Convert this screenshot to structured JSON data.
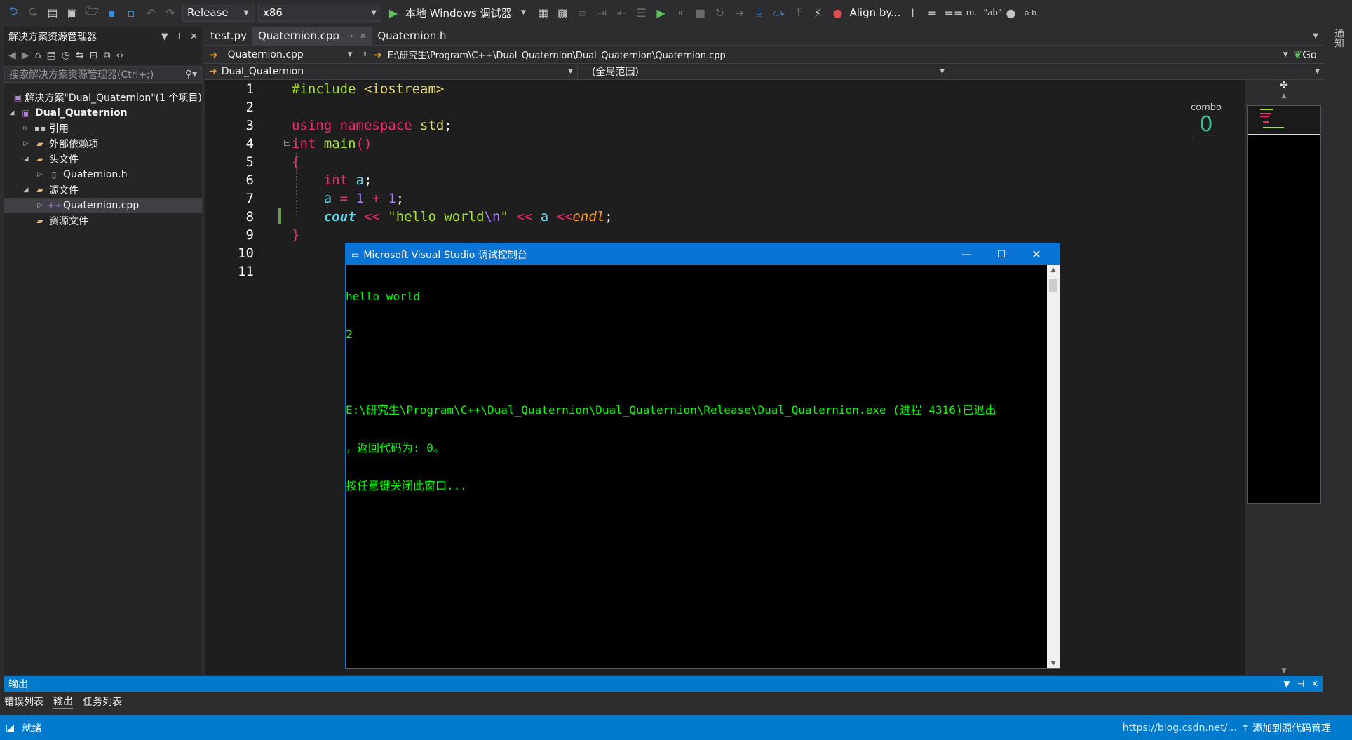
{
  "toolbar": {
    "configuration": "Release",
    "platform": "x86",
    "debugger_label": "本地 Windows 调试器",
    "align_label": "Align by..."
  },
  "right_strip": {
    "label": "通知"
  },
  "solution_explorer": {
    "title": "解决方案资源管理器",
    "search_placeholder": "搜索解决方案资源管理器(Ctrl+;)",
    "items": [
      {
        "label": "解决方案\"Dual_Quaternion\"(1 个项目)"
      },
      {
        "label": "Dual_Quaternion"
      },
      {
        "label": "引用"
      },
      {
        "label": "外部依赖项"
      },
      {
        "label": "头文件"
      },
      {
        "label": "Quaternion.h"
      },
      {
        "label": "源文件"
      },
      {
        "label": "Quaternion.cpp"
      },
      {
        "label": "资源文件"
      }
    ]
  },
  "tabs": [
    {
      "label": "test.py"
    },
    {
      "label": "Quaternion.cpp"
    },
    {
      "label": "Quaternion.h"
    }
  ],
  "nav": {
    "file_combo": "Quaternion.cpp",
    "path": "E:\\研究生\\Program\\C++\\Dual_Quaternion\\Dual_Quaternion\\Quaternion.cpp",
    "go_label": "Go",
    "project_combo": "Dual_Quaternion",
    "scope_combo": "(全局范围)"
  },
  "editor": {
    "line_numbers": [
      "1",
      "2",
      "3",
      "4",
      "5",
      "6",
      "7",
      "8",
      "9",
      "10",
      "11"
    ]
  },
  "combo_counter": {
    "label": "combo",
    "value": "0"
  },
  "console": {
    "title": "Microsoft Visual Studio 调试控制台",
    "lines": [
      "hello world",
      "2",
      "",
      "E:\\研究生\\Program\\C++\\Dual_Quaternion\\Dual_Quaternion\\Release\\Dual_Quaternion.exe (进程 4316)已退出",
      "，返回代码为: 0。",
      "按任意键关闭此窗口..."
    ]
  },
  "output_panel": {
    "title": "输出",
    "tabs": [
      "错误列表",
      "输出",
      "任务列表"
    ]
  },
  "status_bar": {
    "state": "就绪",
    "watermark": "https://blog.csdn.net/...",
    "source_control": "添加到源代码管理"
  },
  "colors": {
    "accent": "#007acc",
    "console_text": "#00ff00",
    "editor_bg": "#1e1e1e"
  }
}
